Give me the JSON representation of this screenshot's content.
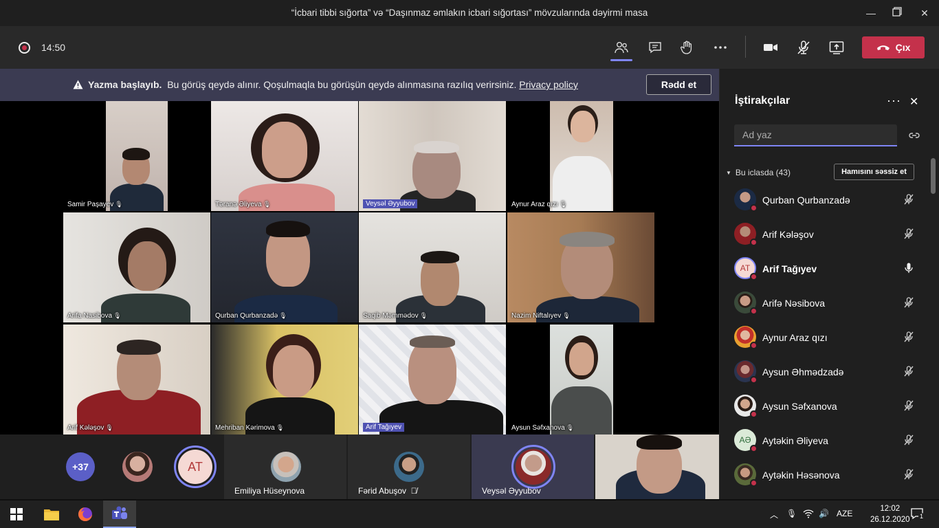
{
  "window": {
    "title": "“İcbari tibbi sığorta” və “Daşınmaz əmlakın icbari sığortası” mövzularında dəyirmi masa"
  },
  "toolbar": {
    "timer": "14:50",
    "leave_label": "Çıx"
  },
  "banner": {
    "bold_text": "Yazma başlayıb.",
    "text": "Bu görüş qeydə alınır. Qoşulmaqla bu görüşün qeydə alınmasına razılıq verirsiniz.",
    "link": "Privacy policy",
    "reject_label": "Rədd et"
  },
  "tiles": [
    {
      "name": "Samir Paşayev"
    },
    {
      "name": "Təranə Əliyeva"
    },
    {
      "name": "Veysəl Əyyubov"
    },
    {
      "name": "Aynur Araz qızı"
    },
    {
      "name": "Arifa Nasibova"
    },
    {
      "name": "Qurban Qurbanzadə"
    },
    {
      "name": "Saqib Məmmədov"
    },
    {
      "name": "Nazim Niftalıyev"
    },
    {
      "name": "Arif Kələşov"
    },
    {
      "name": "Mehriban Kərimova"
    },
    {
      "name": "Arif Tağıyev"
    },
    {
      "name": "Aysun Səfxanova"
    }
  ],
  "strip": {
    "more_count": "+37",
    "at_initials": "AT",
    "cards": [
      "Emiliya Hüseynova",
      "Fərid Abuşov",
      "Veysəl Əyyubov"
    ]
  },
  "panel": {
    "title": "İştirakçılar",
    "search_placeholder": "Ad yaz",
    "section_label": "Bu iclasda (43)",
    "mute_all_label": "Hamısını səssiz et",
    "participants": [
      {
        "name": "Qurban Qurbanzadə",
        "initials": ""
      },
      {
        "name": "Arif Kələşov",
        "initials": ""
      },
      {
        "name": "Arif Tağıyev",
        "initials": "AT"
      },
      {
        "name": "Arifə Nəsibova",
        "initials": ""
      },
      {
        "name": "Aynur Araz qızı",
        "initials": ""
      },
      {
        "name": "Aysun Əhmədzadə",
        "initials": ""
      },
      {
        "name": "Aysun Səfxanova",
        "initials": ""
      },
      {
        "name": "Aytəkin Əliyeva",
        "initials": "AƏ"
      },
      {
        "name": "Aytəkin Həsənova",
        "initials": ""
      }
    ]
  },
  "taskbar": {
    "lang": "AZE",
    "time": "12:02",
    "date": "26.12.2020",
    "notif_count": "1"
  },
  "colors": {
    "accent": "#7f85f5",
    "leave": "#c4314b",
    "banner": "#3b3b52"
  }
}
